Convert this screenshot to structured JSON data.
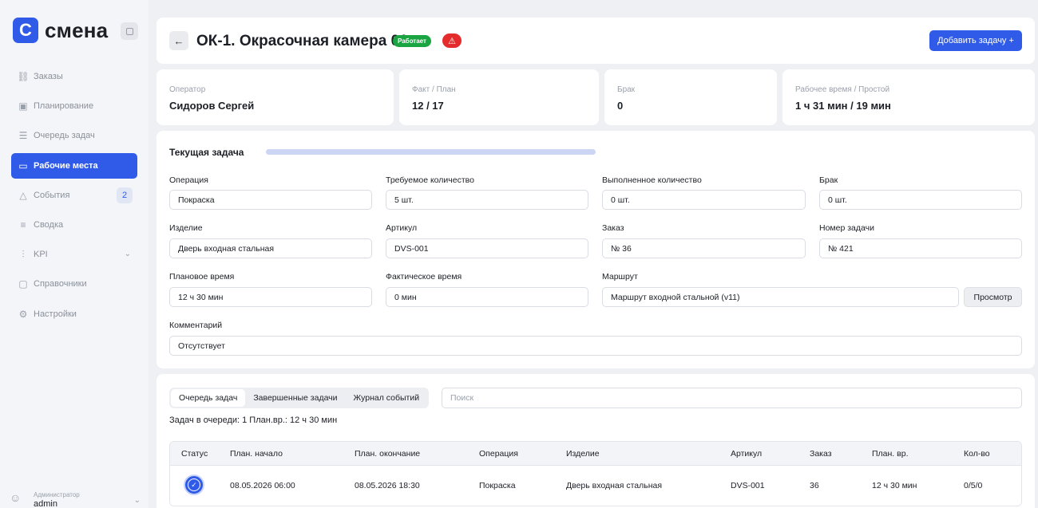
{
  "app": {
    "logo_mark": "С",
    "logo_text": "смена"
  },
  "sidebar": {
    "items": [
      {
        "label": "Заказы",
        "icon": "orders-icon"
      },
      {
        "label": "Планирование",
        "icon": "calendar-icon"
      },
      {
        "label": "Очередь задач",
        "icon": "list-icon"
      },
      {
        "label": "Рабочие места",
        "icon": "monitor-icon",
        "active": true
      },
      {
        "label": "События",
        "icon": "warning-icon",
        "badge": "2"
      },
      {
        "label": "Сводка",
        "icon": "summary-icon"
      },
      {
        "label": "KPI",
        "icon": "bar-chart-icon"
      },
      {
        "label": "Справочники",
        "icon": "book-icon"
      },
      {
        "label": "Настройки",
        "icon": "gear-icon"
      }
    ],
    "user": {
      "role": "Администратор",
      "name": "admin"
    }
  },
  "header": {
    "title": "ОК-1. Окрасочная камера 01",
    "status": "Работает",
    "add_task_label": "Добавить задачу +"
  },
  "stats": [
    {
      "label": "Оператор",
      "value": "Сидоров Сергей"
    },
    {
      "label": "Факт / План",
      "value": "12 / 17"
    },
    {
      "label": "Брак",
      "value": "0"
    },
    {
      "label": "Рабочее время / Простой",
      "value": "1 ч 31 мин / 19 мин"
    }
  ],
  "current_task": {
    "title": "Текущая задача",
    "progress": 1.0,
    "fields": {
      "operation": {
        "label": "Операция",
        "value": "Покраска"
      },
      "required_qty": {
        "label": "Требуемое количество",
        "value": "5 шт."
      },
      "done_qty": {
        "label": "Выполненное количество",
        "value": "0 шт."
      },
      "defect": {
        "label": "Брак",
        "value": "0 шт."
      },
      "product": {
        "label": "Изделие",
        "value": "Дверь входная стальная"
      },
      "article": {
        "label": "Артикул",
        "value": "DVS-001"
      },
      "order": {
        "label": "Заказ",
        "value": "№ 36"
      },
      "task_no": {
        "label": "Номер задачи",
        "value": "№ 421"
      },
      "plan_time": {
        "label": "Плановое время",
        "value": "12 ч 30 мин"
      },
      "fact_time": {
        "label": "Фактическое время",
        "value": "0 мин"
      },
      "route": {
        "label": "Маршрут",
        "value": "Маршрут входной стальной (v11)"
      },
      "comment": {
        "label": "Комментарий",
        "value": "Отсутствует"
      }
    },
    "view_button": "Просмотр"
  },
  "queue": {
    "tabs": [
      "Очередь задач",
      "Завершенные задачи",
      "Журнал событий"
    ],
    "search_placeholder": "Поиск",
    "summary": "Задач в очереди: 1   План.вр.: 12 ч 30 мин",
    "columns": [
      "Статус",
      "План. начало",
      "План. окончание",
      "Операция",
      "Изделие",
      "Артикул",
      "Заказ",
      "План. вр.",
      "Кол-во"
    ],
    "rows": [
      {
        "start": "08.05.2026 06:00",
        "end": "08.05.2026 18:30",
        "operation": "Покраска",
        "product": "Дверь входная стальная",
        "article": "DVS-001",
        "order": "36",
        "plan": "12 ч 30 мин",
        "qty": "0/5/0"
      }
    ]
  }
}
